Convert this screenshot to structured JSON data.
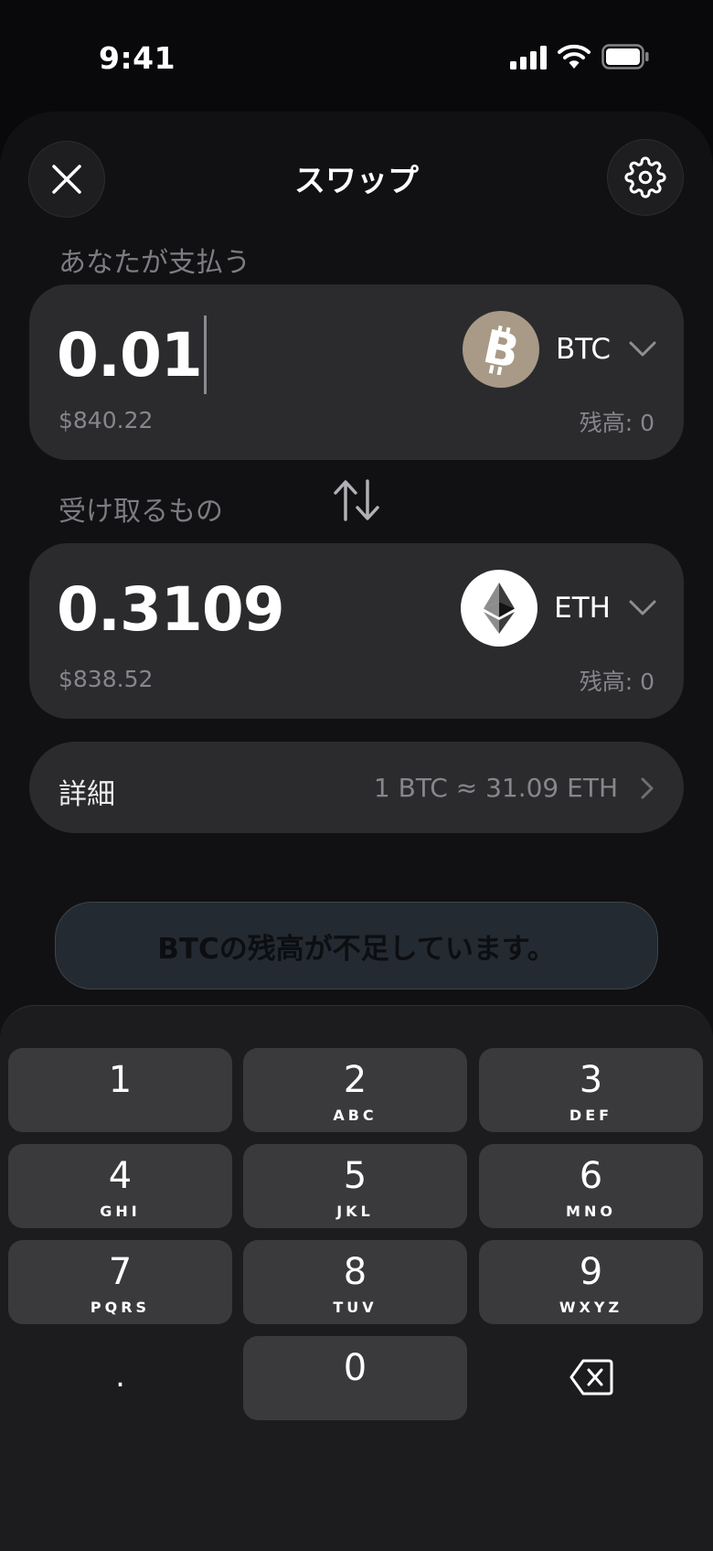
{
  "status_bar": {
    "time": "9:41",
    "icons": [
      "cellular-signal-icon",
      "wifi-icon",
      "battery-icon"
    ]
  },
  "header": {
    "title": "スワップ",
    "close_icon": "close-icon",
    "settings_icon": "gear-icon"
  },
  "pay": {
    "label": "あなたが支払う",
    "amount": "0.01",
    "fiat_value": "$840.22",
    "token": {
      "symbol": "BTC",
      "icon": "bitcoin-icon",
      "color": "#a89a86"
    },
    "balance": "残高: 0"
  },
  "swap_direction_icon": "swap-vertical-arrows-icon",
  "receive": {
    "label": "受け取るもの",
    "amount": "0.3109",
    "fiat_value": "$838.52",
    "token": {
      "symbol": "ETH",
      "icon": "ethereum-icon",
      "color": "#ffffff"
    },
    "balance": "残高: 0"
  },
  "details": {
    "label": "詳細",
    "rate": "1 BTC ≈ 31.09 ETH"
  },
  "action_button": {
    "label": "BTCの残高が不足しています。",
    "state": "disabled"
  },
  "keypad": {
    "keys": [
      {
        "digit": "1",
        "letters": ""
      },
      {
        "digit": "2",
        "letters": "ABC"
      },
      {
        "digit": "3",
        "letters": "DEF"
      },
      {
        "digit": "4",
        "letters": "GHI"
      },
      {
        "digit": "5",
        "letters": "JKL"
      },
      {
        "digit": "6",
        "letters": "MNO"
      },
      {
        "digit": "7",
        "letters": "PQRS"
      },
      {
        "digit": "8",
        "letters": "TUV"
      },
      {
        "digit": "9",
        "letters": "WXYZ"
      },
      {
        "digit": ".",
        "letters": ""
      },
      {
        "digit": "0",
        "letters": ""
      }
    ],
    "backspace_icon": "backspace-icon"
  },
  "colors": {
    "background": "#09090b",
    "sheet": "#111113",
    "card": "#2b2b2e",
    "key": "#3a3a3c",
    "muted_text": "#86868c"
  }
}
